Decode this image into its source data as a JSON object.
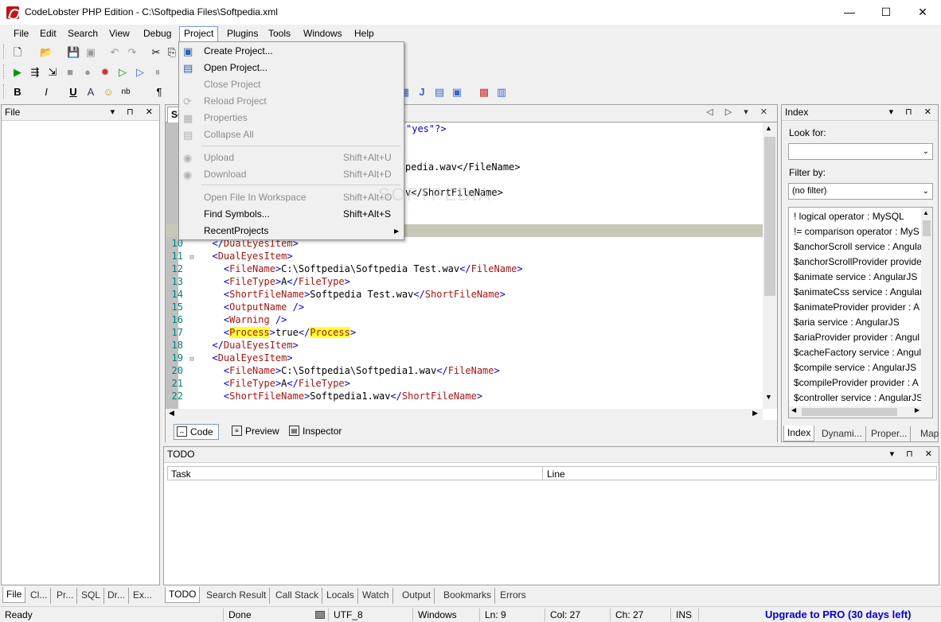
{
  "window": {
    "title": "CodeLobster PHP Edition - C:\\Softpedia Files\\Softpedia.xml",
    "minimize": "—",
    "maximize": "☐",
    "close": "✕"
  },
  "menu": [
    "File",
    "Edit",
    "Search",
    "View",
    "Debug",
    "Project",
    "Plugins",
    "Tools",
    "Windows",
    "Help"
  ],
  "project_menu": {
    "items": [
      {
        "label": "Create Project...",
        "shortcut": "",
        "disabled": false
      },
      {
        "label": "Open Project...",
        "shortcut": "",
        "disabled": false
      },
      {
        "label": "Close Project",
        "shortcut": "",
        "disabled": true
      },
      {
        "label": "Reload Project",
        "shortcut": "",
        "disabled": true
      },
      {
        "label": "Properties",
        "shortcut": "",
        "disabled": true
      },
      {
        "label": "Collapse All",
        "shortcut": "",
        "disabled": true
      },
      {
        "label": "Upload",
        "shortcut": "Shift+Alt+U",
        "disabled": true
      },
      {
        "label": "Download",
        "shortcut": "Shift+Alt+D",
        "disabled": true
      },
      {
        "label": "Open File In Workspace",
        "shortcut": "Shift+Alt+O",
        "disabled": true
      },
      {
        "label": "Find Symbols...",
        "shortcut": "Shift+Alt+S",
        "disabled": false
      },
      {
        "label": "RecentProjects",
        "shortcut": "",
        "disabled": false
      }
    ],
    "submenu_arrow": "▶"
  },
  "file_panel": {
    "title": "File"
  },
  "editor": {
    "tab_label": "Sof",
    "nav": "◁ ▷ ▾ ✕",
    "code_fragments": {
      "top1": "\"yes\"?>",
      "top2": "pedia.wav</FileName>",
      "top3": "v</ShortFileName>"
    },
    "lines": [
      {
        "n": "10",
        "fold": "",
        "indent": "  ",
        "text": "</DualEyesItem>"
      },
      {
        "n": "11",
        "fold": "⊟",
        "indent": "  ",
        "text": "<DualEyesItem>"
      },
      {
        "n": "12",
        "fold": "",
        "indent": "    ",
        "text": "<FileName>C:\\Softpedia\\Softpedia Test.wav</FileName>"
      },
      {
        "n": "13",
        "fold": "",
        "indent": "    ",
        "text": "<FileType>A</FileType>"
      },
      {
        "n": "14",
        "fold": "",
        "indent": "    ",
        "text": "<ShortFileName>Softpedia Test.wav</ShortFileName>"
      },
      {
        "n": "15",
        "fold": "",
        "indent": "    ",
        "text": "<OutputName />"
      },
      {
        "n": "16",
        "fold": "",
        "indent": "    ",
        "text": "<Warning />"
      },
      {
        "n": "17",
        "fold": "",
        "indent": "    ",
        "text": "<Process>true</Process>"
      },
      {
        "n": "18",
        "fold": "",
        "indent": "  ",
        "text": "</DualEyesItem>"
      },
      {
        "n": "19",
        "fold": "⊟",
        "indent": "  ",
        "text": "<DualEyesItem>"
      },
      {
        "n": "20",
        "fold": "",
        "indent": "    ",
        "text": "<FileName>C:\\Softpedia\\Softpedia1.wav</FileName>"
      },
      {
        "n": "21",
        "fold": "",
        "indent": "    ",
        "text": "<FileType>A</FileType>"
      },
      {
        "n": "22",
        "fold": "",
        "indent": "    ",
        "text": "<ShortFileName>Softpedia1.wav</ShortFileName>"
      }
    ],
    "view_tabs": [
      "Code",
      "Preview",
      "Inspector"
    ]
  },
  "index_panel": {
    "title": "Index",
    "look_for_label": "Look for:",
    "look_for_value": "",
    "filter_label": "Filter by:",
    "filter_value": "(no filter)",
    "items": [
      "! logical operator : MySQL",
      "!= comparison operator : MyS",
      "$anchorScroll service : Angula",
      "$anchorScrollProvider provide",
      "$animate service : AngularJS",
      "$animateCss service : Angular",
      "$animateProvider provider : A",
      "$aria service : AngularJS",
      "$ariaProvider provider : Angul",
      "$cacheFactory service : Angul",
      "$compile service : AngularJS",
      "$compileProvider provider : A",
      "$controller service : AngularJS"
    ],
    "tabs": [
      "Index",
      "Dynami...",
      "Proper...",
      "Map"
    ]
  },
  "todo_panel": {
    "title": "TODO",
    "columns": [
      "Task",
      "Line"
    ]
  },
  "left_bottom_tabs": [
    "File",
    "Cl...",
    "Pr...",
    "SQL",
    "Dr...",
    "Ex..."
  ],
  "bottom_tabs": [
    "TODO",
    "Search Result",
    "Call Stack",
    "Locals",
    "Watch",
    "Output",
    "Bookmarks",
    "Errors"
  ],
  "status": {
    "ready": "Ready",
    "done": "Done",
    "encoding": "UTF_8",
    "lineend": "Windows",
    "ln": "Ln: 9",
    "col": "Col: 27",
    "ch": "Ch: 27",
    "mode": "INS",
    "upgrade": "Upgrade to PRO (30 days left)"
  },
  "watermark": "SOFTPEDIA",
  "colors": {
    "accent": "#0000c0",
    "tag": "#a31515",
    "highlight": "#ffff33",
    "upgrade": "#0000cc"
  }
}
